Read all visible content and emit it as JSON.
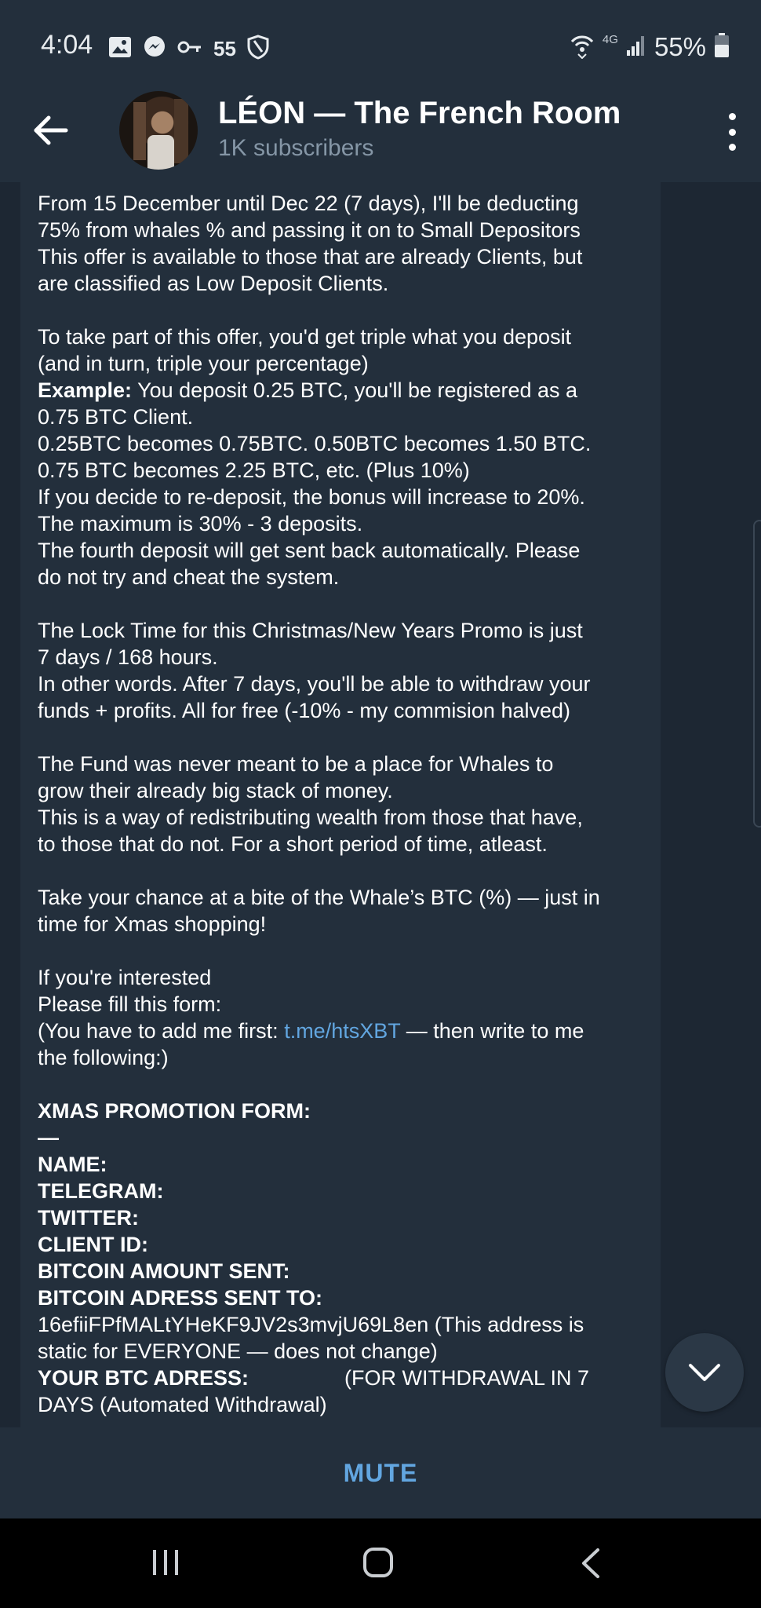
{
  "status_bar": {
    "time": "4:04",
    "notification_count": "55",
    "network_label": "4G",
    "battery_percent": "55%"
  },
  "header": {
    "channel_name": "LÉON — The French Room",
    "subscribers": "1K subscribers"
  },
  "message": {
    "p1_lines": [
      "From 15 December until Dec 22 (7 days), I'll be deducting",
      "75% from whales % and passing it on to Small Depositors",
      "This offer is available to those that are already Clients, but",
      "are classified as Low Deposit Clients."
    ],
    "p2_l1": "To take part of this offer, you'd get triple what you deposit",
    "p2_l2": "(and in turn, triple your percentage)",
    "example_label": "Example:",
    "example_text": " You deposit 0.25 BTC, you'll be registered as a",
    "p2_rest": [
      "0.75 BTC Client.",
      "0.25BTC becomes 0.75BTC. 0.50BTC becomes 1.50 BTC.",
      "0.75 BTC becomes 2.25 BTC, etc. (Plus 10%)",
      "If you decide to re-deposit, the bonus will increase to 20%.",
      "The maximum is 30% - 3 deposits.",
      "The fourth deposit will get sent back automatically. Please",
      "do not try and cheat the system."
    ],
    "p3_lines": [
      "The Lock Time for this Christmas/New Years Promo is just",
      "7 days / 168 hours.",
      "In other words. After 7 days, you'll be able to withdraw your",
      "funds + profits. All for free (-10% - my commision halved)"
    ],
    "p4_lines": [
      "The Fund was never meant to be a place for Whales to",
      "grow their already big stack of money.",
      "This is a way of redistributing wealth from those that have,",
      "to those that do not. For a short period of time, atleast."
    ],
    "p5_lines": [
      "Take your chance at a bite of the Whale’s BTC (%) — just in",
      "time for Xmas shopping!"
    ],
    "p6_l1": "If you're interested",
    "p6_l2": "Please fill this form:",
    "p6_l3_pre": "(You have to add me first: ",
    "p6_link": "t.me/htsXBT",
    "p6_l3_post": " — then write to me",
    "p6_l4": "the following:)",
    "form_title": "XMAS PROMOTION FORM:",
    "form_dash": "—",
    "form_fields": [
      "NAME:",
      "TELEGRAM:",
      "TWITTER:",
      "CLIENT ID:",
      "BITCOIN AMOUNT SENT:",
      "BITCOIN ADRESS SENT TO:"
    ],
    "address_line": "16efiiFPfMALtYHeKF9JV2s3mvjU69L8en (This address is",
    "address_note": "static for EVERYONE — does not change)",
    "your_btc_label": "YOUR BTC ADRESS:",
    "withdrawal_note": "(FOR WITHDRAWAL IN 7",
    "withdrawal_note_2": "DAYS (Automated Withdrawal)"
  },
  "bottom_bar": {
    "mute_label": "MUTE"
  },
  "colors": {
    "background": "#1d2733",
    "header": "#232f3c",
    "accent_link": "#62a6e0",
    "subtitle": "#8596a6"
  },
  "icons": {
    "back": "arrow-left-icon",
    "menu": "more-vertical-icon",
    "scroll_down": "chevron-down-icon"
  }
}
